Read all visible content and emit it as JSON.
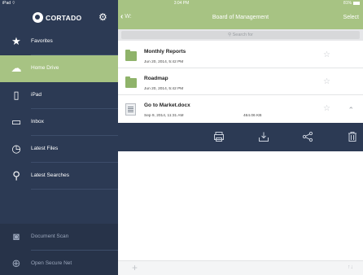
{
  "status_bar": {
    "device": "iPad",
    "wifi": "⌔",
    "time": "3:04 PM",
    "battery": "81%"
  },
  "sidebar": {
    "brand": "CORTADO",
    "items": [
      {
        "label": "Favorites",
        "icon": "star-icon",
        "glyph": "★"
      },
      {
        "label": "Home Drive",
        "icon": "cloud-icon",
        "glyph": "☁"
      },
      {
        "label": "iPad",
        "icon": "tablet-icon",
        "glyph": "▯"
      },
      {
        "label": "Inbox",
        "icon": "inbox-icon",
        "glyph": "▭"
      },
      {
        "label": "Latest Files",
        "icon": "clock-icon",
        "glyph": "◷"
      },
      {
        "label": "Latest Searches",
        "icon": "magnifier-icon",
        "glyph": "⚲"
      }
    ],
    "bottom_items": [
      {
        "label": "Document Scan",
        "icon": "camera-icon",
        "glyph": "◙"
      },
      {
        "label": "Open Secure Net",
        "icon": "globe-icon",
        "glyph": "⊕"
      }
    ],
    "active_index": 1
  },
  "header": {
    "back_label": "W:",
    "title": "Board of Management",
    "select_label": "Select"
  },
  "search": {
    "placeholder": "Search for"
  },
  "files": [
    {
      "name": "Monthly Reports",
      "date": "Jun 20, 2014, 5:42 PM",
      "size": "",
      "type": "folder"
    },
    {
      "name": "Roadmap",
      "date": "Jun 20, 2014, 5:42 PM",
      "size": "",
      "type": "folder"
    },
    {
      "name": "Go to Market.docx",
      "date": "Sep 9, 2014, 11:31 AM",
      "size": "464.06 KB",
      "type": "document"
    }
  ],
  "actions": [
    "print-icon",
    "download-icon",
    "share-icon",
    "trash-icon"
  ],
  "colors": {
    "accent_green": "#a7c383",
    "sidebar_navy": "#2c3a54",
    "folder_green": "#8fb36a"
  }
}
